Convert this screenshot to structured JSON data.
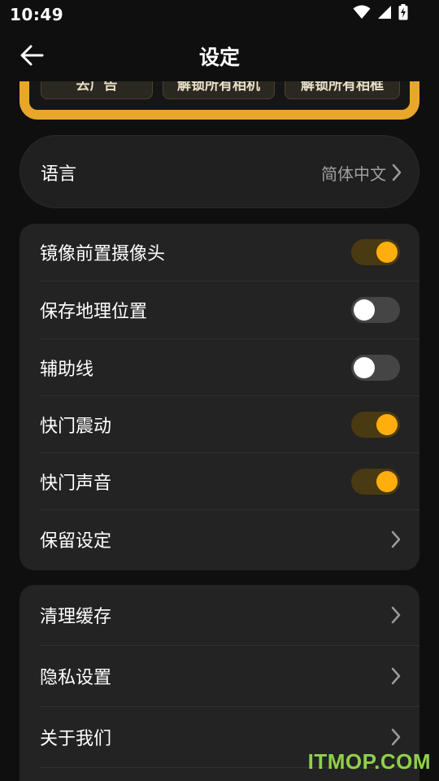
{
  "status_bar": {
    "time": "10:49",
    "icons": [
      "wifi-icon",
      "cellular-signal-icon",
      "battery-charging-icon"
    ]
  },
  "header": {
    "title": "设定",
    "back_icon": "arrow-left-icon"
  },
  "promo": {
    "buttons": [
      "去广告",
      "解锁所有相机",
      "解锁所有相框"
    ],
    "border_color": "#e8a62a"
  },
  "language": {
    "label": "语言",
    "value": "简体中文"
  },
  "settings_group": {
    "items": [
      {
        "label": "镜像前置摄像头",
        "type": "toggle",
        "on": true
      },
      {
        "label": "保存地理位置",
        "type": "toggle",
        "on": false
      },
      {
        "label": "辅助线",
        "type": "toggle",
        "on": false
      },
      {
        "label": "快门震动",
        "type": "toggle",
        "on": true
      },
      {
        "label": "快门声音",
        "type": "toggle",
        "on": true
      },
      {
        "label": "保留设定",
        "type": "link"
      }
    ]
  },
  "misc_group": {
    "items": [
      {
        "label": "清理缓存"
      },
      {
        "label": "隐私设置"
      },
      {
        "label": "关于我们"
      }
    ]
  },
  "watermark": "ITMOP.COM",
  "colors": {
    "accent": "#ffae0d",
    "background": "#0f0f0f",
    "card": "#232323"
  }
}
